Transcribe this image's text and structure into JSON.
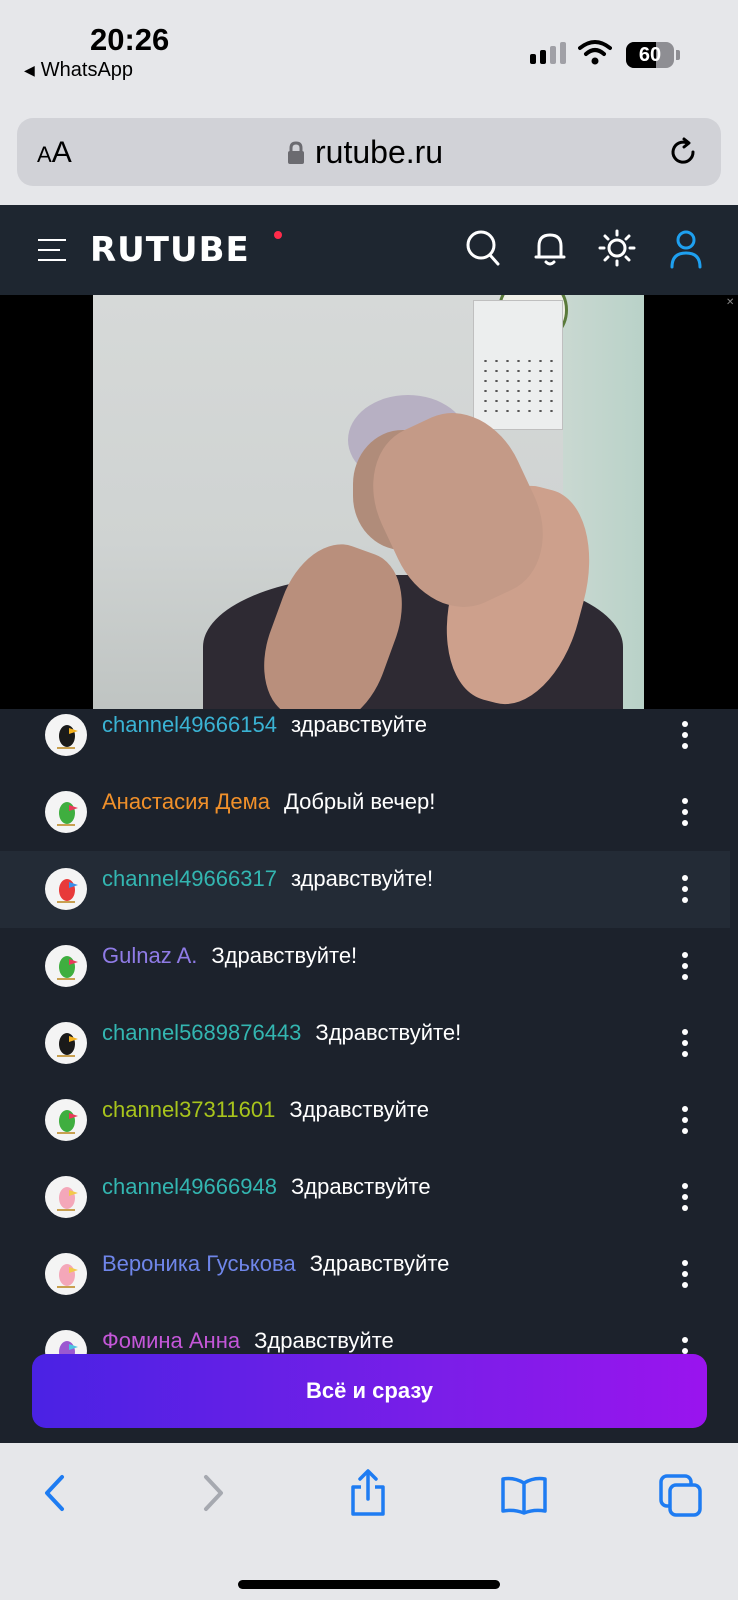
{
  "status_bar": {
    "time": "20:26",
    "back_label": "WhatsApp",
    "battery": "60"
  },
  "browser": {
    "aa_small": "A",
    "aa_big": "A",
    "url": "rutube.ru"
  },
  "site_header": {
    "logo": "RUTUBE",
    "icons": [
      "menu-icon",
      "search-icon",
      "bell-icon",
      "theme-icon",
      "profile-icon"
    ]
  },
  "chat": {
    "messages": [
      {
        "user": "channel49666154",
        "text": "здравствуйте",
        "color": "#3ab3d4"
      },
      {
        "user": "Анастасия Дема",
        "text": "Добрый вечер!",
        "color": "#f0902a"
      },
      {
        "user": "channel49666317",
        "text": "здравствуйте!",
        "color": "#33b6b1"
      },
      {
        "user": "Gulnaz A.",
        "text": "Здравствуйте!",
        "color": "#8f7be6"
      },
      {
        "user": "channel5689876443",
        "text": "Здравствуйте!",
        "color": "#33b6b1"
      },
      {
        "user": "channel37311601",
        "text": "Здравствуйте",
        "color": "#a8c41c"
      },
      {
        "user": "channel49666948",
        "text": "Здравствуйте",
        "color": "#33b6b1"
      },
      {
        "user": "Вероника Гуськова",
        "text": "Здравствуйте",
        "color": "#6f86ea"
      },
      {
        "user": "Фомина Анна",
        "text": "Здравствуйте",
        "color": "#c457d8"
      }
    ]
  },
  "cta": {
    "label": "Всё и сразу"
  },
  "colors": {
    "site_bg": "#1c222c",
    "accent_blue": "#1ea0f0",
    "cta_start": "#4a22e4",
    "cta_end": "#9a14ee"
  }
}
